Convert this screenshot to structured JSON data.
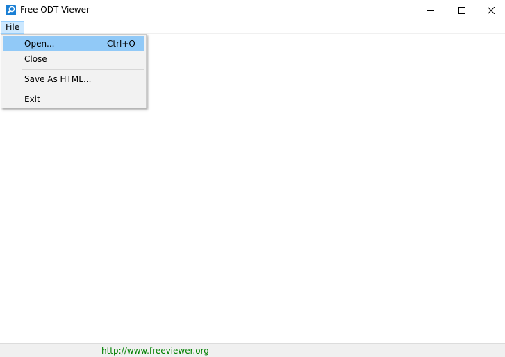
{
  "window": {
    "title": "Free ODT Viewer",
    "icon": "magnifier-icon",
    "controls": [
      "minimize-icon",
      "maximize-icon",
      "close-icon"
    ]
  },
  "menubar": {
    "file_label": "File"
  },
  "file_menu": {
    "items": [
      {
        "label": "Open...",
        "shortcut": "Ctrl+O",
        "highlighted": true
      },
      {
        "label": "Close",
        "shortcut": ""
      },
      {
        "label": "Save As HTML...",
        "shortcut": ""
      },
      {
        "label": "Exit",
        "shortcut": ""
      }
    ]
  },
  "statusbar": {
    "link": "http://www.freeviewer.org"
  },
  "colors": {
    "menu_highlight": "#91c9f7",
    "menubar_active": "#cce8ff",
    "status_link": "#008000",
    "icon_blue": "#1a7fd4"
  }
}
